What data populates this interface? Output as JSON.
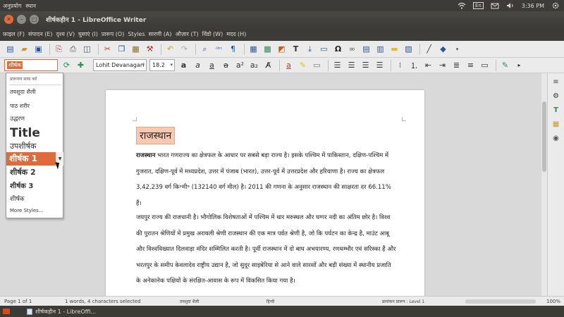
{
  "top_panel": {
    "left": [
      "अनुप्रयोग",
      "स्थान"
    ],
    "time": "3:36 PM",
    "keyboard": "En"
  },
  "window": {
    "title": "शीर्षकहीन 1 - LibreOffice Writer"
  },
  "menubar": [
    "फ़ाइल (F)",
    "संपादन (E)",
    "दृश्य (V)",
    "घुसाएं (I)",
    "प्रारूप (O)",
    "Styles",
    "सारणी (A)",
    "औज़ार (T)",
    "विंडो (W)",
    "मदद (H)"
  ],
  "formatting": {
    "style_value": "शीर्षक",
    "font_name": "Lohit Devanagari",
    "font_size": "18.2"
  },
  "dropdown": {
    "clear": "प्रारूपण साफ़ करें",
    "items": [
      "तयशुदा शैली",
      "पाठ शरीर",
      "उद्धरण",
      "Title",
      "उपशीर्षक",
      "शीर्षक 1",
      "शीर्षक 2",
      "शीर्षक 3",
      "शीर्षक",
      "More Styles..."
    ]
  },
  "document": {
    "heading": "राजस्थान",
    "para1_bold": "राजस्थान",
    "para1": " भारत गणराज्य का क्षेत्रफल के आधार पर सबसे बड़ा राज्य है। इसके पश्चिम में पाकिस्तान, दक्षिण-पश्चिम में गुजरात, दक्षिण-पूर्व में मध्यप्रदेश, उत्तर में पंजाब (भारत), उत्तर-पूर्व में उत्तरप्रदेश और हरियाणा है। राज्य का क्षेत्रफल 3,42,239 वर्ग कि॰मी॰ (132140 वर्ग मील) है। 2011 की गणना के अनुसार राजस्थान की साक्षरता दर 66.11% हैं।",
    "para2": "जयपुर राज्य की राजधानी है। भौगोलिक विशेषताओं में पश्चिम में थार मरुस्थल और घग्गर नदी का अंतिम छोर है। विश्व की पुरातन श्रेणियों में प्रमुख अरावली श्रेणी राजस्थान की एक मात्र पर्वत श्रेणी है, जो कि पर्यटन का केन्द्र है, माउंट आबू और विश्वविख्यात दिलवाड़ा मंदिर सम्मिलित करती है। पूर्वी राजस्थान में दो बाघ अभयारण्य, रणथम्भौर एवं सरिस्का हैं और भरतपुर के समीप केवलादेव राष्ट्रीय उद्यान है, जो सुदूर साइबेरिया से आने वाले सारसों और बड़ी संख्या में स्थानीय प्रजाति के अनेकानेक पक्षियों के संरक्षित-आवास के रूप में विकसित किया गया है।"
  },
  "statusbar": {
    "page": "Page 1 of 1",
    "words": "1 words, 4 characters selected",
    "style": "तयशुदा शैली",
    "language": "हिन्दी",
    "outline": "क्रमांकन प्रारूप : Level 1",
    "zoom": "100%"
  },
  "taskbar": {
    "task": "शीर्षकहीन 1 - LibreOffi..."
  }
}
